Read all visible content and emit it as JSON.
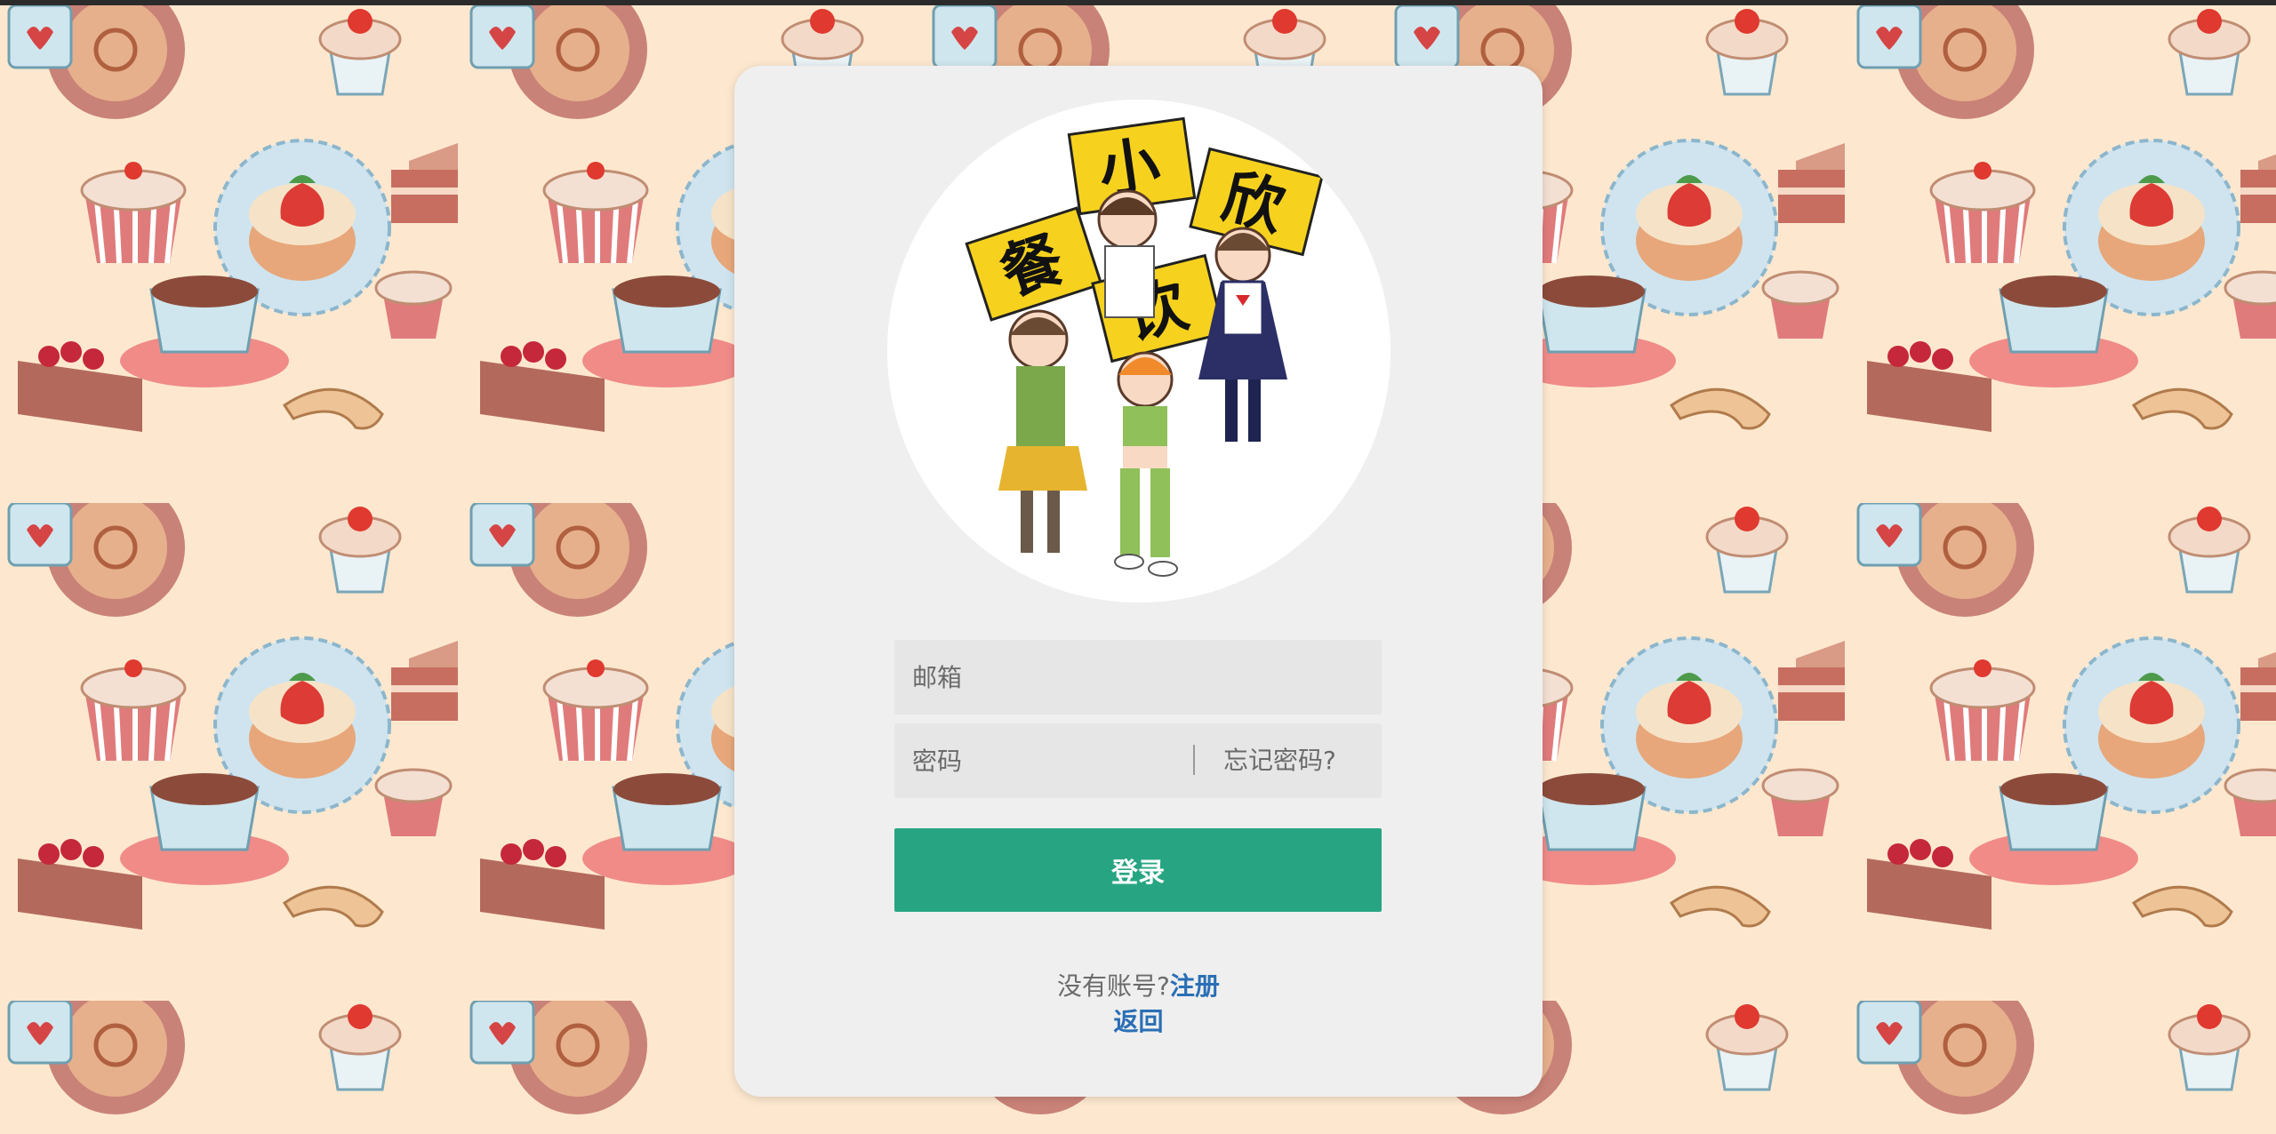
{
  "logo": {
    "characters": [
      "小",
      "欣",
      "餐",
      "饮"
    ]
  },
  "form": {
    "email_placeholder": "邮箱",
    "password_placeholder": "密码",
    "forgot_label": "忘记密码?",
    "login_label": "登录"
  },
  "footer": {
    "no_account_text": "没有账号?",
    "register_label": "注册",
    "back_label": "返回"
  },
  "colors": {
    "background": "#fde8cf",
    "card": "#efefef",
    "primary_button": "#27a583",
    "link": "#2a6fb5"
  }
}
